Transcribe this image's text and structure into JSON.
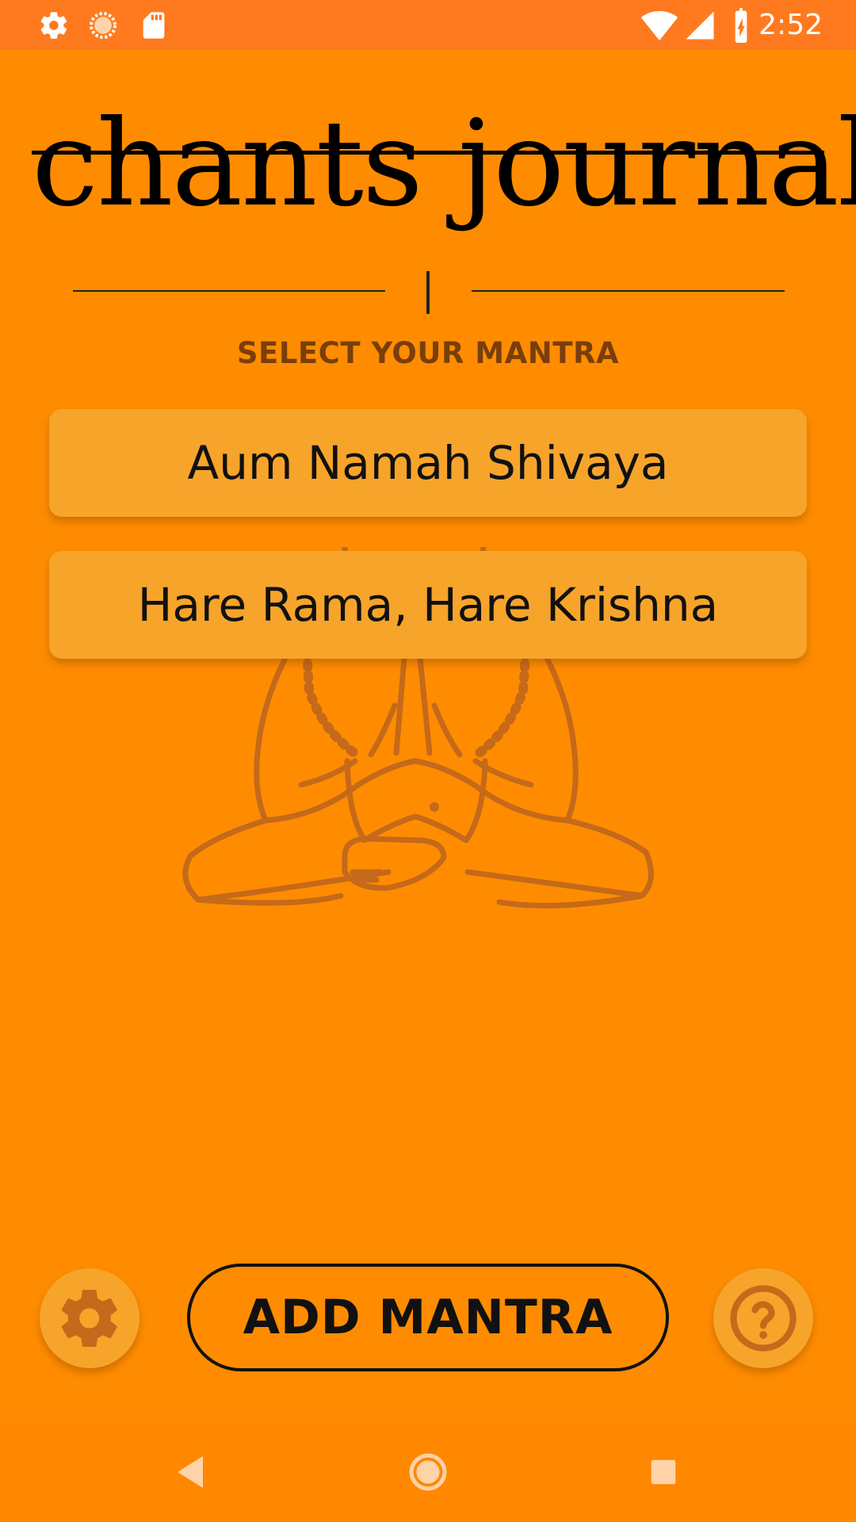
{
  "status_bar": {
    "time": "2:52",
    "left_icons": [
      "gear-icon",
      "circle-spinner-icon",
      "sd-card-icon"
    ],
    "right_icons": [
      "wifi-icon",
      "signal-icon",
      "battery-charging-icon"
    ]
  },
  "app": {
    "title": "chants journal",
    "section_label": "SELECT YOUR MANTRA"
  },
  "mantras": [
    {
      "label": "Aum Namah Shivaya"
    },
    {
      "label": "Hare Rama, Hare Krishna"
    }
  ],
  "actions": {
    "add_mantra_label": "ADD MANTRA",
    "settings_icon": "gear-icon",
    "help_icon": "question-circle-icon"
  },
  "nav_bar": {
    "buttons": [
      "back-icon",
      "home-icon",
      "recents-icon"
    ]
  },
  "colors": {
    "background": "#FF8C00",
    "status_bar": "#FF7A1E",
    "card": "#F7A42B",
    "accent_dark": "#7A3E0A",
    "watermark": "#C5691A"
  }
}
